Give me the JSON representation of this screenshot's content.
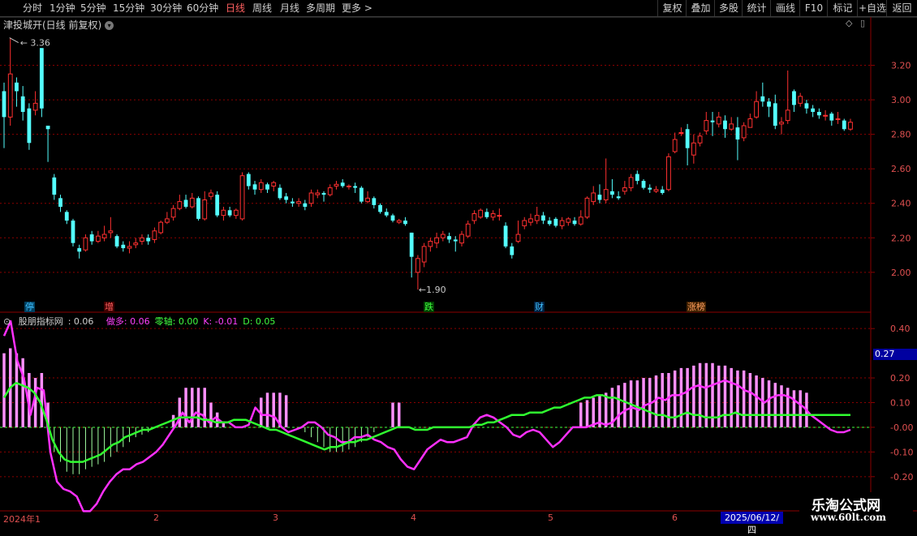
{
  "toolbar": {
    "periods": [
      "分时",
      "1分钟",
      "5分钟",
      "15分钟",
      "30分钟",
      "60分钟",
      "日线",
      "周线",
      "月线",
      "多周期",
      "更多 >"
    ],
    "active_period": "日线",
    "buttons": [
      "复权",
      "叠加",
      "多股",
      "统计",
      "画线",
      "F10",
      "标记",
      "+自选",
      "返回"
    ]
  },
  "stock": {
    "title": "津投城开(日线 前复权)"
  },
  "price_axis": {
    "labels": [
      "3.20",
      "3.00",
      "2.80",
      "2.60",
      "2.40",
      "2.20",
      "2.00"
    ],
    "values": [
      3.2,
      3.0,
      2.8,
      2.6,
      2.4,
      2.2,
      2.0
    ]
  },
  "annotations": {
    "high": "3.36",
    "low": "1.90"
  },
  "events": [
    {
      "text": "停",
      "color": "#40c0ff",
      "bg": "#004060"
    },
    {
      "text": "增",
      "color": "#ff6060",
      "bg": "#400000"
    },
    {
      "text": "跌",
      "color": "#40ff40",
      "bg": "#004000"
    },
    {
      "text": "财",
      "color": "#40c0ff",
      "bg": "#002040"
    },
    {
      "text": "涨榜",
      "color": "#ffa060",
      "bg": "#402000"
    }
  ],
  "indicator": {
    "name": "股朋指标网",
    "value": ": 0.06",
    "items": [
      {
        "label": "做多: 0.06",
        "color": "#ff40ff"
      },
      {
        "label": "零轴: 0.00",
        "color": "#40ff40"
      },
      {
        "label": "K: -0.01",
        "color": "#ff40ff"
      },
      {
        "label": "D: 0.05",
        "color": "#40ff40"
      }
    ],
    "axis_labels": [
      "0.40",
      "0.20",
      "0.10",
      "-0.00",
      "-0.10",
      "-0.20"
    ],
    "axis_values": [
      0.4,
      0.2,
      0.1,
      0.0,
      -0.1,
      -0.2
    ],
    "current": "0.27"
  },
  "x_axis": {
    "labels": [
      "2024年1",
      "2",
      "3",
      "4",
      "5",
      "6"
    ],
    "cursor_date": "2025/06/12/四"
  },
  "watermark": {
    "line1": "乐淘公式网",
    "line2": "www.60lt.com"
  },
  "colors": {
    "up": "#ff3030",
    "down": "#54ffff",
    "k_line": "#ff30ff",
    "d_line": "#30ff30",
    "grid": "#8b0000"
  },
  "chart_data": {
    "type": "candlestick",
    "price_range": [
      1.83,
      3.4
    ],
    "indicator_range": [
      -0.24,
      0.44
    ],
    "candles": [
      [
        3.05,
        2.9,
        3.1,
        2.72
      ],
      [
        2.9,
        3.15,
        3.36,
        2.85
      ],
      [
        3.1,
        3.05,
        3.13,
        2.96
      ],
      [
        3.02,
        2.93,
        3.08,
        2.88
      ],
      [
        2.95,
        2.75,
        2.98,
        2.71
      ],
      [
        2.94,
        2.98,
        3.05,
        2.91
      ],
      [
        3.3,
        2.95,
        3.3,
        2.9
      ],
      [
        2.85,
        2.83,
        2.85,
        2.64
      ],
      [
        2.55,
        2.45,
        2.57,
        2.42
      ],
      [
        2.43,
        2.38,
        2.45,
        2.35
      ],
      [
        2.35,
        2.3,
        2.36,
        2.28
      ],
      [
        2.3,
        2.17,
        2.31,
        2.15
      ],
      [
        2.14,
        2.12,
        2.16,
        2.08
      ],
      [
        2.13,
        2.2,
        2.22,
        2.12
      ],
      [
        2.22,
        2.18,
        2.24,
        2.16
      ],
      [
        2.18,
        2.21,
        2.24,
        2.17
      ],
      [
        2.2,
        2.22,
        2.27,
        2.18
      ],
      [
        2.23,
        2.24,
        2.32,
        2.2
      ],
      [
        2.21,
        2.15,
        2.22,
        2.14
      ],
      [
        2.16,
        2.14,
        2.18,
        2.12
      ],
      [
        2.14,
        2.15,
        2.18,
        2.11
      ],
      [
        2.16,
        2.17,
        2.2,
        2.14
      ],
      [
        2.18,
        2.2,
        2.22,
        2.16
      ],
      [
        2.2,
        2.18,
        2.22,
        2.16
      ],
      [
        2.19,
        2.24,
        2.26,
        2.17
      ],
      [
        2.23,
        2.29,
        2.3,
        2.22
      ],
      [
        2.29,
        2.31,
        2.35,
        2.28
      ],
      [
        2.32,
        2.37,
        2.39,
        2.3
      ],
      [
        2.37,
        2.41,
        2.45,
        2.36
      ],
      [
        2.42,
        2.38,
        2.45,
        2.37
      ],
      [
        2.38,
        2.43,
        2.46,
        2.37
      ],
      [
        2.43,
        2.31,
        2.44,
        2.3
      ],
      [
        2.31,
        2.42,
        2.47,
        2.3
      ],
      [
        2.44,
        2.46,
        2.48,
        2.42
      ],
      [
        2.45,
        2.33,
        2.47,
        2.32
      ],
      [
        2.33,
        2.36,
        2.38,
        2.3
      ],
      [
        2.36,
        2.33,
        2.38,
        2.32
      ],
      [
        2.33,
        2.36,
        2.37,
        2.31
      ],
      [
        2.31,
        2.56,
        2.58,
        2.3
      ],
      [
        2.57,
        2.5,
        2.58,
        2.48
      ],
      [
        2.51,
        2.48,
        2.53,
        2.45
      ],
      [
        2.48,
        2.52,
        2.54,
        2.46
      ],
      [
        2.51,
        2.48,
        2.52,
        2.46
      ],
      [
        2.5,
        2.52,
        2.53,
        2.47
      ],
      [
        2.49,
        2.43,
        2.51,
        2.42
      ],
      [
        2.44,
        2.42,
        2.46,
        2.4
      ],
      [
        2.41,
        2.4,
        2.43,
        2.38
      ],
      [
        2.4,
        2.41,
        2.43,
        2.38
      ],
      [
        2.4,
        2.38,
        2.42,
        2.36
      ],
      [
        2.4,
        2.46,
        2.48,
        2.38
      ],
      [
        2.45,
        2.46,
        2.48,
        2.43
      ],
      [
        2.46,
        2.45,
        2.47,
        2.41
      ],
      [
        2.45,
        2.49,
        2.51,
        2.44
      ],
      [
        2.5,
        2.51,
        2.53,
        2.48
      ],
      [
        2.52,
        2.5,
        2.54,
        2.49
      ],
      [
        2.5,
        2.5,
        2.51,
        2.48
      ],
      [
        2.5,
        2.49,
        2.52,
        2.46
      ],
      [
        2.49,
        2.41,
        2.5,
        2.4
      ],
      [
        2.41,
        2.43,
        2.47,
        2.4
      ],
      [
        2.43,
        2.39,
        2.44,
        2.37
      ],
      [
        2.39,
        2.35,
        2.4,
        2.34
      ],
      [
        2.35,
        2.33,
        2.37,
        2.32
      ],
      [
        2.33,
        2.3,
        2.34,
        2.29
      ],
      [
        2.29,
        2.3,
        2.31,
        2.28
      ],
      [
        2.3,
        2.28,
        2.32,
        2.27
      ],
      [
        2.23,
        2.09,
        2.23,
        1.97
      ],
      [
        2.0,
        2.08,
        2.1,
        1.9
      ],
      [
        2.06,
        2.15,
        2.17,
        2.03
      ],
      [
        2.15,
        2.18,
        2.2,
        2.12
      ],
      [
        2.17,
        2.2,
        2.23,
        2.14
      ],
      [
        2.2,
        2.22,
        2.24,
        2.18
      ],
      [
        2.21,
        2.19,
        2.23,
        2.17
      ],
      [
        2.19,
        2.18,
        2.21,
        2.12
      ],
      [
        2.17,
        2.22,
        2.24,
        2.15
      ],
      [
        2.21,
        2.28,
        2.3,
        2.2
      ],
      [
        2.3,
        2.34,
        2.36,
        2.28
      ],
      [
        2.32,
        2.36,
        2.37,
        2.31
      ],
      [
        2.35,
        2.32,
        2.37,
        2.31
      ],
      [
        2.32,
        2.34,
        2.36,
        2.3
      ],
      [
        2.33,
        2.33,
        2.37,
        2.3
      ],
      [
        2.27,
        2.15,
        2.29,
        2.14
      ],
      [
        2.15,
        2.1,
        2.17,
        2.08
      ],
      [
        2.18,
        2.22,
        2.3,
        2.17
      ],
      [
        2.27,
        2.3,
        2.32,
        2.25
      ],
      [
        2.29,
        2.31,
        2.34,
        2.27
      ],
      [
        2.3,
        2.33,
        2.38,
        2.28
      ],
      [
        2.33,
        2.3,
        2.35,
        2.28
      ],
      [
        2.3,
        2.28,
        2.32,
        2.27
      ],
      [
        2.31,
        2.27,
        2.32,
        2.26
      ],
      [
        2.27,
        2.3,
        2.32,
        2.25
      ],
      [
        2.29,
        2.31,
        2.32,
        2.27
      ],
      [
        2.3,
        2.28,
        2.32,
        2.27
      ],
      [
        2.28,
        2.32,
        2.36,
        2.27
      ],
      [
        2.32,
        2.43,
        2.44,
        2.31
      ],
      [
        2.41,
        2.46,
        2.5,
        2.39
      ],
      [
        2.45,
        2.42,
        2.51,
        2.4
      ],
      [
        2.42,
        2.48,
        2.66,
        2.4
      ],
      [
        2.47,
        2.45,
        2.54,
        2.43
      ],
      [
        2.44,
        2.43,
        2.47,
        2.42
      ],
      [
        2.47,
        2.49,
        2.53,
        2.45
      ],
      [
        2.49,
        2.55,
        2.57,
        2.47
      ],
      [
        2.57,
        2.53,
        2.59,
        2.51
      ],
      [
        2.53,
        2.49,
        2.54,
        2.48
      ],
      [
        2.49,
        2.48,
        2.51,
        2.46
      ],
      [
        2.47,
        2.48,
        2.5,
        2.46
      ],
      [
        2.48,
        2.46,
        2.5,
        2.45
      ],
      [
        2.48,
        2.67,
        2.69,
        2.47
      ],
      [
        2.7,
        2.77,
        2.81,
        2.69
      ],
      [
        2.81,
        2.81,
        2.84,
        2.79
      ],
      [
        2.83,
        2.72,
        2.86,
        2.62
      ],
      [
        2.68,
        2.75,
        2.8,
        2.63
      ],
      [
        2.75,
        2.79,
        2.81,
        2.73
      ],
      [
        2.82,
        2.88,
        2.93,
        2.8
      ],
      [
        2.88,
        2.87,
        2.93,
        2.79
      ],
      [
        2.86,
        2.9,
        2.93,
        2.84
      ],
      [
        2.88,
        2.83,
        2.91,
        2.78
      ],
      [
        2.83,
        2.86,
        2.9,
        2.82
      ],
      [
        2.84,
        2.77,
        2.9,
        2.65
      ],
      [
        2.78,
        2.85,
        2.87,
        2.76
      ],
      [
        2.84,
        2.89,
        2.92,
        2.84
      ],
      [
        2.9,
        2.99,
        3.05,
        2.89
      ],
      [
        3.02,
        2.99,
        3.1,
        2.96
      ],
      [
        2.99,
        2.96,
        3.01,
        2.9
      ],
      [
        2.98,
        2.85,
        3.03,
        2.83
      ],
      [
        2.86,
        2.87,
        2.9,
        2.8
      ],
      [
        2.88,
        2.94,
        3.17,
        2.86
      ],
      [
        3.05,
        2.97,
        3.06,
        2.93
      ],
      [
        2.98,
        3.02,
        3.04,
        2.96
      ],
      [
        2.98,
        2.95,
        3.0,
        2.92
      ],
      [
        2.95,
        2.93,
        2.97,
        2.9
      ],
      [
        2.93,
        2.91,
        2.95,
        2.89
      ],
      [
        2.91,
        2.91,
        2.94,
        2.88
      ],
      [
        2.92,
        2.88,
        2.93,
        2.85
      ],
      [
        2.89,
        2.89,
        2.93,
        2.86
      ],
      [
        2.88,
        2.83,
        2.89,
        2.82
      ],
      [
        2.83,
        2.87,
        2.89,
        2.82
      ]
    ],
    "k_series": [
      0.37,
      0.43,
      0.27,
      0.2,
      0.05,
      0.16,
      0.15,
      -0.1,
      -0.22,
      -0.25,
      -0.26,
      -0.28,
      -0.34,
      -0.34,
      -0.31,
      -0.26,
      -0.22,
      -0.19,
      -0.17,
      -0.17,
      -0.15,
      -0.14,
      -0.12,
      -0.1,
      -0.07,
      -0.03,
      0.01,
      0.06,
      0.02,
      0.06,
      0.05,
      0.02,
      0.04,
      0.02,
      0.02,
      0.0,
      0.0,
      0.01,
      0.08,
      0.05,
      0.05,
      0.04,
      0.0,
      -0.02,
      -0.01,
      0.0,
      0.02,
      0.02,
      0.0,
      -0.03,
      -0.04,
      -0.06,
      -0.06,
      -0.04,
      -0.04,
      -0.03,
      -0.05,
      -0.06,
      -0.08,
      -0.09,
      -0.13,
      -0.16,
      -0.17,
      -0.13,
      -0.09,
      -0.07,
      -0.05,
      -0.06,
      -0.06,
      -0.05,
      -0.04,
      0.01,
      0.04,
      0.05,
      0.04,
      0.02,
      0.0,
      -0.03,
      -0.04,
      -0.02,
      -0.01,
      -0.02,
      -0.05,
      -0.08,
      -0.06,
      -0.03,
      0.0,
      0.0,
      0.0,
      0.01,
      0.02,
      0.01,
      0.02,
      0.05,
      0.07,
      0.08,
      0.07,
      0.09,
      0.1,
      0.12,
      0.11,
      0.13,
      0.13,
      0.14,
      0.16,
      0.17,
      0.16,
      0.17,
      0.18,
      0.19,
      0.18,
      0.17,
      0.15,
      0.14,
      0.12,
      0.1,
      0.12,
      0.13,
      0.13,
      0.12,
      0.1,
      0.08,
      0.05,
      0.03,
      0.01,
      -0.01,
      -0.02,
      -0.02,
      -0.01
    ],
    "d_series": [
      0.12,
      0.16,
      0.18,
      0.17,
      0.16,
      0.14,
      0.1,
      0.03,
      -0.05,
      -0.1,
      -0.13,
      -0.14,
      -0.14,
      -0.14,
      -0.13,
      -0.12,
      -0.11,
      -0.09,
      -0.07,
      -0.06,
      -0.04,
      -0.03,
      -0.02,
      -0.01,
      -0.01,
      0.0,
      0.01,
      0.02,
      0.03,
      0.04,
      0.04,
      0.04,
      0.04,
      0.03,
      0.03,
      0.02,
      0.02,
      0.02,
      0.03,
      0.03,
      0.03,
      0.02,
      0.01,
      0.0,
      -0.01,
      -0.01,
      -0.02,
      -0.03,
      -0.04,
      -0.05,
      -0.06,
      -0.07,
      -0.08,
      -0.09,
      -0.08,
      -0.08,
      -0.07,
      -0.06,
      -0.06,
      -0.05,
      -0.05,
      -0.04,
      -0.03,
      -0.02,
      -0.01,
      0.0,
      0.0,
      0.0,
      -0.01,
      -0.01,
      -0.01,
      0.0,
      0.0,
      0.0,
      0.0,
      0.0,
      0.0,
      0.0,
      0.01,
      0.01,
      0.02,
      0.02,
      0.03,
      0.04,
      0.05,
      0.05,
      0.05,
      0.06,
      0.06,
      0.06,
      0.07,
      0.08,
      0.08,
      0.09,
      0.1,
      0.11,
      0.12,
      0.12,
      0.13,
      0.13,
      0.12,
      0.12,
      0.11,
      0.1,
      0.09,
      0.08,
      0.07,
      0.06,
      0.05,
      0.05,
      0.04,
      0.04,
      0.05,
      0.06,
      0.05,
      0.05,
      0.04,
      0.04,
      0.04,
      0.05,
      0.05,
      0.06,
      0.05,
      0.05,
      0.05,
      0.05,
      0.05,
      0.05,
      0.05,
      0.05,
      0.05,
      0.05,
      0.05,
      0.05,
      0.05,
      0.05,
      0.05,
      0.05,
      0.05,
      0.05,
      0.05
    ],
    "bars": [
      0.3,
      0.32,
      0.3,
      0.28,
      0.22,
      0.2,
      0.22,
      0.1,
      -0.1,
      -0.14,
      -0.18,
      -0.19,
      -0.19,
      -0.17,
      -0.16,
      -0.15,
      -0.14,
      -0.12,
      -0.1,
      -0.08,
      -0.06,
      -0.04,
      -0.03,
      -0.02,
      0.0,
      0.0,
      0.0,
      0.05,
      0.12,
      0.16,
      0.16,
      0.16,
      0.16,
      0.1,
      0.06,
      0.02,
      0.0,
      0.0,
      0.0,
      0.0,
      0.0,
      0.12,
      0.14,
      0.14,
      0.14,
      0.13,
      0.0,
      0.0,
      -0.02,
      -0.04,
      -0.06,
      -0.08,
      -0.1,
      -0.1,
      -0.1,
      -0.09,
      -0.08,
      -0.06,
      -0.04,
      -0.02,
      0.0,
      0.0,
      0.1,
      0.1,
      0.0,
      0.0,
      0.0,
      0.0,
      0.0,
      0.0,
      0.0,
      0.0,
      0.0,
      0.0,
      0.0,
      0.0,
      0.0,
      0.0,
      0.0,
      0.0,
      0.0,
      0.0,
      0.0,
      0.0,
      0.0,
      0.0,
      0.0,
      0.0,
      0.0,
      0.0,
      0.0,
      0.0,
      0.1,
      0.11,
      0.12,
      0.13,
      0.14,
      0.16,
      0.17,
      0.18,
      0.19,
      0.19,
      0.2,
      0.2,
      0.21,
      0.22,
      0.22,
      0.23,
      0.24,
      0.24,
      0.25,
      0.26,
      0.26,
      0.26,
      0.25,
      0.25,
      0.24,
      0.23,
      0.23,
      0.22,
      0.21,
      0.2,
      0.19,
      0.18,
      0.17,
      0.16,
      0.15,
      0.15,
      0.14
    ]
  }
}
